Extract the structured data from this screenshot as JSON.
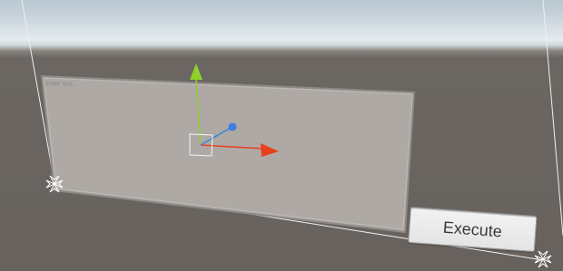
{
  "input_field": {
    "placeholder": "Enter text..."
  },
  "execute_button": {
    "label": "Execute"
  },
  "colors": {
    "sky_top": "#b9c7d1",
    "horizon": "#e4ebef",
    "ground": "#67625e",
    "panel_fill": "#aea9a5",
    "panel_border": "#8f8a86",
    "gizmo_y_axis": "#8fd12a",
    "gizmo_x_axis": "#e8401c",
    "gizmo_z_axis": "#3f7fe0",
    "button_fill": "#ececec",
    "button_text": "#3a3a3a"
  },
  "icons": {
    "move_tool": "transform-gizmo-icon",
    "corner_handle": "rect-transform-anchor-icon"
  }
}
